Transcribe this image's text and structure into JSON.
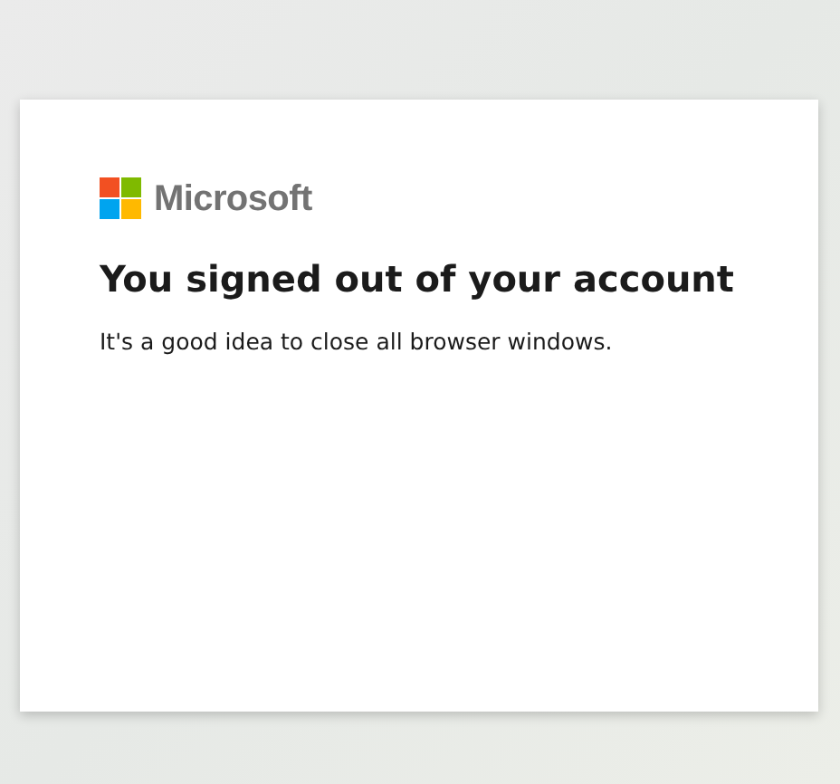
{
  "logo": {
    "text": "Microsoft"
  },
  "title": "You signed out of your account",
  "message": "It's a good idea to close all browser windows."
}
